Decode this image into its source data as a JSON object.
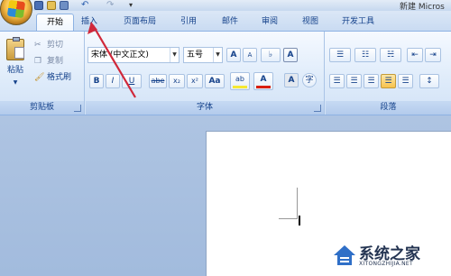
{
  "titlebar": {
    "window_title": "新建 Micros"
  },
  "quick_access": {
    "undo": "↶",
    "redo": "↷",
    "more": "▾"
  },
  "tabs": [
    {
      "label": "开始"
    },
    {
      "label": "插入"
    },
    {
      "label": "页面布局"
    },
    {
      "label": "引用"
    },
    {
      "label": "邮件"
    },
    {
      "label": "审阅"
    },
    {
      "label": "视图"
    },
    {
      "label": "开发工具"
    }
  ],
  "clipboard": {
    "paste": "粘贴",
    "cut": "剪切",
    "copy": "复制",
    "format_painter": "格式刷",
    "group_label": "剪贴板"
  },
  "font": {
    "font_name": "宋体 (中文正文)",
    "font_size": "五号",
    "grow": "A",
    "shrink": "A",
    "change_case": "Aa",
    "clear_format": "A",
    "bold": "B",
    "italic": "I",
    "underline": "U",
    "strike": "abe",
    "subscript": "x₂",
    "superscript": "x²",
    "highlight": "ab",
    "font_color": "A",
    "char_shading": "A",
    "enclose": "字",
    "group_label": "字体"
  },
  "paragraph": {
    "group_label": "段落"
  },
  "watermark": {
    "text": "系统之家",
    "url": "XITONGZHIJIA.NET"
  },
  "colors": {
    "accent": "#15428b",
    "arrow": "#d0283a",
    "font_color": "#d81e06",
    "highlight": "#f5e833"
  }
}
